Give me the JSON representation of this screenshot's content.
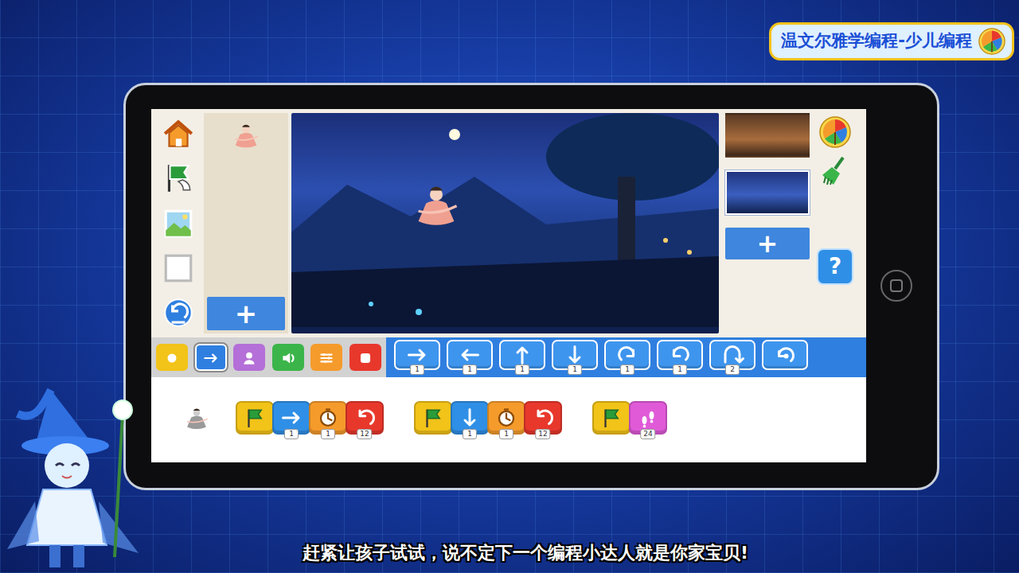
{
  "banner": {
    "title": "温文尔雅学编程-少儿编程"
  },
  "sprite_panel": {
    "add": "+"
  },
  "scenes": [
    {
      "selected": false
    },
    {
      "selected": true
    }
  ],
  "scene_panel": {
    "add": "+"
  },
  "help": "?",
  "categories": [
    {
      "kind": "trigger",
      "color": "#f2c318",
      "selected": false
    },
    {
      "kind": "motion",
      "color": "#2f7fe0",
      "selected": true
    },
    {
      "kind": "looks",
      "color": "#b56fd8",
      "selected": false
    },
    {
      "kind": "sound",
      "color": "#3bb54a",
      "selected": false
    },
    {
      "kind": "control",
      "color": "#f59b2c",
      "selected": false
    },
    {
      "kind": "end",
      "color": "#e8382c",
      "selected": false
    }
  ],
  "palette": [
    {
      "kind": "move-right",
      "count": "1"
    },
    {
      "kind": "move-left",
      "count": "1"
    },
    {
      "kind": "move-up",
      "count": "1"
    },
    {
      "kind": "move-down",
      "count": "1"
    },
    {
      "kind": "turn-right",
      "count": "1"
    },
    {
      "kind": "turn-left",
      "count": "1"
    },
    {
      "kind": "hop",
      "count": "2"
    },
    {
      "kind": "go-home",
      "count": ""
    }
  ],
  "scripts": [
    {
      "blocks": [
        {
          "kind": "flag",
          "color": "#f2c318",
          "count": ""
        },
        {
          "kind": "move-right",
          "color": "#2f8fe6",
          "count": "1"
        },
        {
          "kind": "wait",
          "color": "#f59b2c",
          "count": "1"
        },
        {
          "kind": "repeat",
          "color": "#e8382c",
          "count": "12"
        }
      ]
    },
    {
      "blocks": [
        {
          "kind": "flag",
          "color": "#f2c318",
          "count": ""
        },
        {
          "kind": "move-down",
          "color": "#2f8fe6",
          "count": "1"
        },
        {
          "kind": "wait",
          "color": "#f59b2c",
          "count": "1"
        },
        {
          "kind": "repeat",
          "color": "#e8382c",
          "count": "12"
        }
      ]
    },
    {
      "blocks": [
        {
          "kind": "flag",
          "color": "#f2c318",
          "count": ""
        },
        {
          "kind": "walk",
          "color": "#e05ad8",
          "count": "24"
        }
      ]
    }
  ],
  "subtitle": "赶紧让孩子试试，说不定下一个编程小达人就是你家宝贝!"
}
